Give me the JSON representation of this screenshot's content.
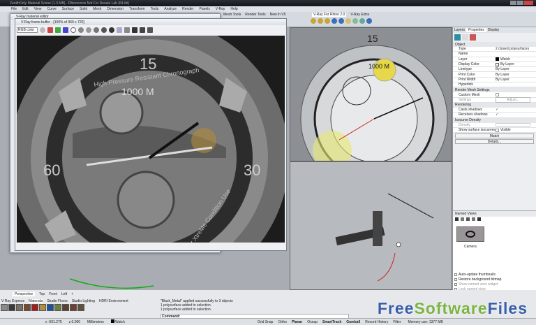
{
  "title": "ZenithOnly Material Scene (1.3 MB) - Rhinoceros Not For Resale Lab (64-bit)",
  "menu": [
    "File",
    "Edit",
    "View",
    "Curve",
    "Surface",
    "Solid",
    "Mesh",
    "Dimension",
    "Transform",
    "Tools",
    "Analyze",
    "Render",
    "Panels",
    "V-Ray",
    "Help"
  ],
  "toolbar_tabs": [
    "Mesh Tools",
    "Render Tools",
    "New in V5"
  ],
  "vray_tabs": [
    "V-Ray For Rhino 2.0",
    "V-Ray Extra"
  ],
  "material_editor": {
    "title": "V-Ray material editor"
  },
  "frame_buffer": {
    "title": "V-Ray frame buffer - [100% of 960 x 720]",
    "channel": "RGB color"
  },
  "watch": {
    "brand_text": "High Pressure Resistant Chronograph",
    "bottom_text": "For XtreMe Condition Use",
    "depth": "1000 M",
    "n15": "15",
    "n30": "30",
    "n60": "60"
  },
  "properties": {
    "tabs": [
      "Layers",
      "Properties",
      "Display"
    ],
    "object_header": "Object",
    "rows": [
      {
        "k": "Type",
        "v": "2 closed polysurfaces"
      },
      {
        "k": "Name",
        "v": ""
      },
      {
        "k": "Layer",
        "v": "Watch"
      },
      {
        "k": "Display Color",
        "v": "By Layer"
      },
      {
        "k": "Linetype",
        "v": "By Layer"
      },
      {
        "k": "Print Color",
        "v": "By Layer"
      },
      {
        "k": "Print Width",
        "v": "By Layer"
      },
      {
        "k": "Hyperlink",
        "v": ""
      }
    ],
    "render_mesh_header": "Render Mesh Settings",
    "custom_mesh": "Custom Mesh",
    "settings": "Settings",
    "adjust": "Adjust...",
    "rendering_header": "Rendering",
    "casts_shadows": "Casts shadows",
    "receives_shadows": "Receives shadows",
    "isocurve_header": "Isocurve Density",
    "density": "Density",
    "show_isocurves": "Show surface isocurves",
    "visible": "Visible",
    "match": "Match",
    "details": "Details..."
  },
  "named_views": {
    "title": "Named Views",
    "item": "Camera",
    "options": [
      "Auto-update thumbnails",
      "Restore background bitmap",
      "Show named view widget",
      "Lock named view",
      "Auto-select named view widgets"
    ]
  },
  "viewport_tabs": [
    "Perspective",
    "Top",
    "Front",
    "Left"
  ],
  "material_tabs": [
    "V-Ray Express",
    "Materials",
    "Studio Floors",
    "Studio Lighting",
    "HDRI Environment"
  ],
  "material_colors": [
    "#8a8a8a",
    "#3a3a3a",
    "#7a7060",
    "#7a4a30",
    "#a02020",
    "#b09040",
    "#2050a0",
    "#6a8040",
    "#5a4030",
    "#704030",
    "#605040"
  ],
  "command_history": [
    "\"Black_Metal\" applied successfully to 3 objects",
    "1 polysurface added to selection.",
    "1 polysurface added to selection."
  ],
  "command_label": "Command:",
  "status": {
    "x": "x -501.275",
    "z": "z 0.000",
    "units": "Millimeters",
    "layer": "Watch",
    "toggles": [
      "Grid Snap",
      "Ortho",
      "Planar",
      "Osnap",
      "SmartTrack",
      "Gumball",
      "Record History",
      "Filter"
    ],
    "memory": "Memory use: 1377 MB"
  },
  "watermark": {
    "a": "Free",
    "b": "Software",
    "c": "Files",
    ".com": ".com"
  }
}
